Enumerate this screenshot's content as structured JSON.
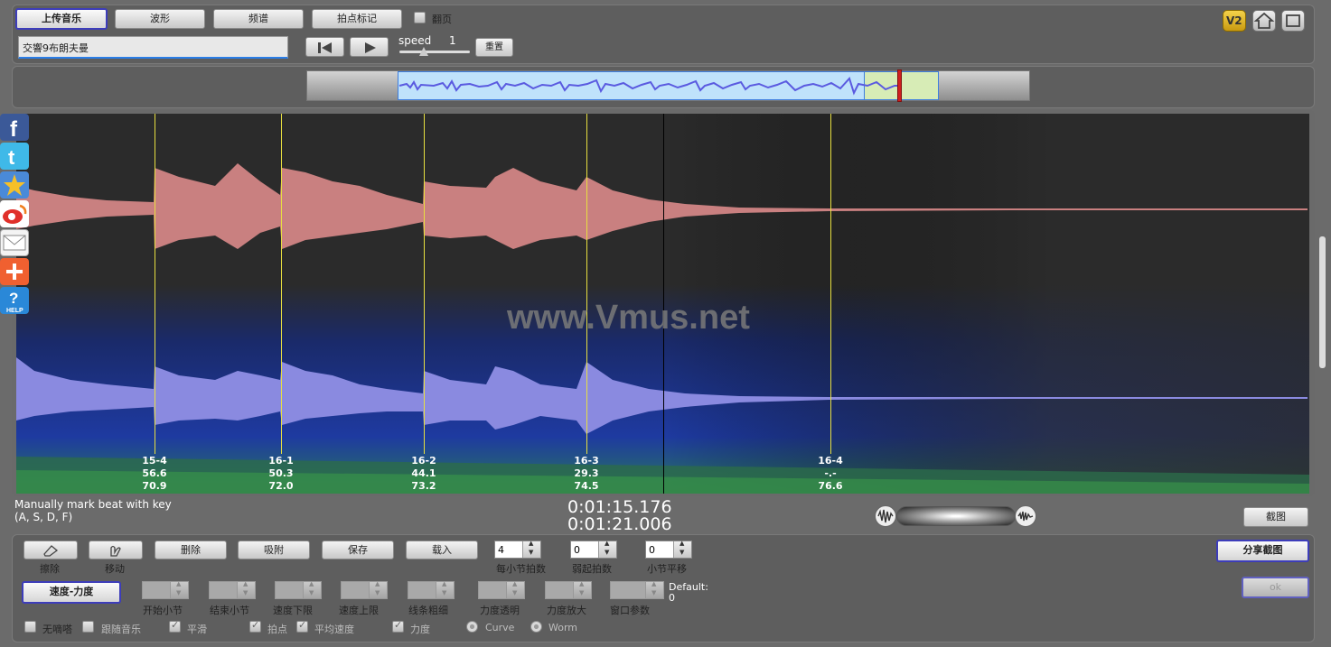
{
  "toolbar": {
    "upload": "上传音乐",
    "waveform": "波形",
    "spectrum": "频谱",
    "beat_mark": "拍点标记",
    "flip_page": "翻页",
    "song_name": "交響9布朗夫曼",
    "speed_label": "speed",
    "speed_value": "1",
    "reset": "重置",
    "v2": "V2"
  },
  "beats": [
    {
      "label": "15-4",
      "v1": "56.6",
      "v2": "70.9"
    },
    {
      "label": "16-1",
      "v1": "50.3",
      "v2": "72.0"
    },
    {
      "label": "16-2",
      "v1": "44.1",
      "v2": "73.2"
    },
    {
      "label": "16-3",
      "v1": "29.3",
      "v2": "74.5"
    },
    {
      "label": "16-4",
      "v1": "-.-",
      "v2": "76.6"
    }
  ],
  "watermark": "www.Vmus.net",
  "status": {
    "hint_line1": "Manually mark beat with key",
    "hint_line2": "(A, S, D, F)",
    "time_current": "0:01:15.176",
    "time_total": "0:01:21.006",
    "screenshot": "截图"
  },
  "controls": {
    "erase": "擦除",
    "move": "移动",
    "delete": "删除",
    "snap": "吸附",
    "save": "保存",
    "load": "载入",
    "beats_per_bar_value": "4",
    "beats_per_bar_label": "每小节拍数",
    "pickup_value": "0",
    "pickup_label": "弱起拍数",
    "bar_offset_value": "0",
    "bar_offset_label": "小节平移",
    "share_screenshot": "分享截图",
    "tempo_dynamics": "速度-力度",
    "start_bar": "开始小节",
    "end_bar": "结束小节",
    "tempo_min": "速度下限",
    "tempo_max": "速度上限",
    "line_width": "线条粗细",
    "dyn_opacity": "力度透明",
    "dyn_zoom": "力度放大",
    "window_param": "窗口参数",
    "default_label": "Default:",
    "default_value": "0",
    "ok_btn": "ok",
    "no_click": "无嘀嗒",
    "follow_music": "跟随音乐",
    "smooth": "平滑",
    "beat_point": "拍点",
    "avg_tempo": "平均速度",
    "dynamics": "力度",
    "curve": "Curve",
    "worm": "Worm"
  }
}
